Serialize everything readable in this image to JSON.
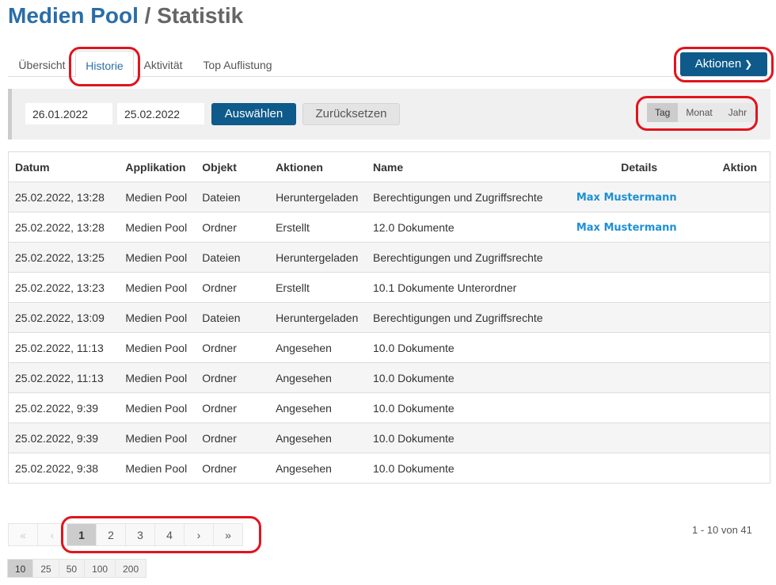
{
  "header": {
    "title_app": "Medien Pool",
    "title_sep": " / ",
    "title_page": "Statistik"
  },
  "tabs": [
    {
      "label": "Übersicht"
    },
    {
      "label": "Historie"
    },
    {
      "label": "Aktivität"
    },
    {
      "label": "Top Auflistung"
    }
  ],
  "actions": {
    "label": "Aktionen",
    "icon": "chevron-down-icon"
  },
  "filter": {
    "date_from": "26.01.2022",
    "date_to": "25.02.2022",
    "select_label": "Auswählen",
    "reset_label": "Zurücksetzen",
    "periods": [
      "Tag",
      "Monat",
      "Jahr"
    ],
    "active_period": "Tag"
  },
  "table": {
    "columns": [
      "Datum",
      "Applikation",
      "Objekt",
      "Aktionen",
      "Name",
      "Details",
      "Aktion"
    ],
    "rows": [
      {
        "datum": "25.02.2022, 13:28",
        "applikation": "Medien Pool",
        "objekt": "Dateien",
        "aktion": "Heruntergeladen",
        "name": "Berechtigungen und Zugriffsrechte",
        "details": "Max Mustermann"
      },
      {
        "datum": "25.02.2022, 13:28",
        "applikation": "Medien Pool",
        "objekt": "Ordner",
        "aktion": "Erstellt",
        "name": "12.0 Dokumente",
        "details": "Max Mustermann"
      },
      {
        "datum": "25.02.2022, 13:25",
        "applikation": "Medien Pool",
        "objekt": "Dateien",
        "aktion": "Heruntergeladen",
        "name": "Berechtigungen und Zugriffsrechte",
        "details": ""
      },
      {
        "datum": "25.02.2022, 13:23",
        "applikation": "Medien Pool",
        "objekt": "Ordner",
        "aktion": "Erstellt",
        "name": "10.1 Dokumente Unterordner",
        "details": ""
      },
      {
        "datum": "25.02.2022, 13:09",
        "applikation": "Medien Pool",
        "objekt": "Dateien",
        "aktion": "Heruntergeladen",
        "name": "Berechtigungen und Zugriffsrechte",
        "details": ""
      },
      {
        "datum": "25.02.2022, 11:13",
        "applikation": "Medien Pool",
        "objekt": "Ordner",
        "aktion": "Angesehen",
        "name": "10.0 Dokumente",
        "details": ""
      },
      {
        "datum": "25.02.2022, 11:13",
        "applikation": "Medien Pool",
        "objekt": "Ordner",
        "aktion": "Angesehen",
        "name": "10.0 Dokumente",
        "details": ""
      },
      {
        "datum": "25.02.2022, 9:39",
        "applikation": "Medien Pool",
        "objekt": "Ordner",
        "aktion": "Angesehen",
        "name": "10.0 Dokumente",
        "details": ""
      },
      {
        "datum": "25.02.2022, 9:39",
        "applikation": "Medien Pool",
        "objekt": "Ordner",
        "aktion": "Angesehen",
        "name": "10.0 Dokumente",
        "details": ""
      },
      {
        "datum": "25.02.2022, 9:38",
        "applikation": "Medien Pool",
        "objekt": "Ordner",
        "aktion": "Angesehen",
        "name": "10.0 Dokumente",
        "details": ""
      }
    ]
  },
  "pagination": {
    "first": "«",
    "prev": "‹",
    "pages": [
      "1",
      "2",
      "3",
      "4"
    ],
    "next": "›",
    "last": "»",
    "current": "1",
    "range_info": "1 - 10 von 41"
  },
  "page_sizes": {
    "options": [
      "10",
      "25",
      "50",
      "100",
      "200"
    ],
    "selected": "10"
  },
  "colors": {
    "primary": "#0e5a8a",
    "title": "#2a6ea8",
    "link": "#1e90d6",
    "annotation": "#e0141e"
  }
}
